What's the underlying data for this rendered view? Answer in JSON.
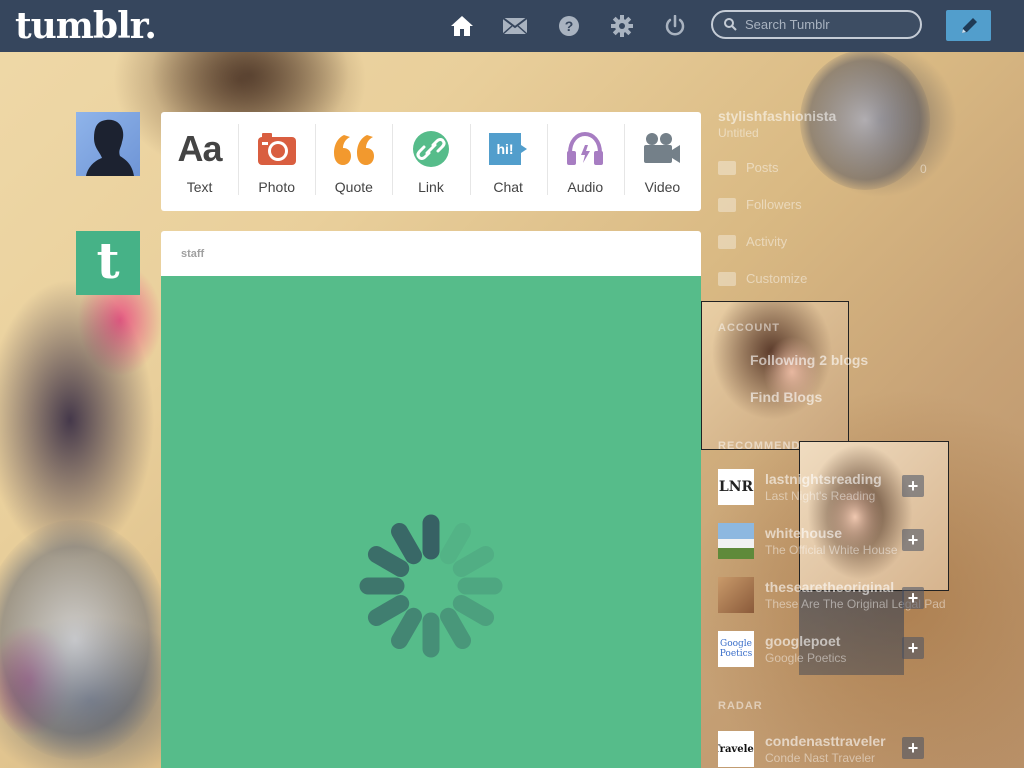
{
  "header": {
    "logo": "tumblr.",
    "search_placeholder": "Search Tumblr",
    "icons": [
      "home-icon",
      "mail-icon",
      "help-icon",
      "gear-icon",
      "power-icon"
    ]
  },
  "post_types": [
    {
      "label": "Text",
      "icon": "text-icon",
      "glyph": "Aa",
      "color": "#444444"
    },
    {
      "label": "Photo",
      "icon": "camera-icon",
      "color": "#d95e40"
    },
    {
      "label": "Quote",
      "icon": "quote-icon",
      "glyph": "“",
      "color": "#f2992e"
    },
    {
      "label": "Link",
      "icon": "link-icon",
      "color": "#56bc8a"
    },
    {
      "label": "Chat",
      "icon": "chat-icon",
      "glyph": "hi!",
      "color": "#529ecc"
    },
    {
      "label": "Audio",
      "icon": "headphones-icon",
      "color": "#a77dc2"
    },
    {
      "label": "Video",
      "icon": "video-camera-icon",
      "color": "#748089"
    }
  ],
  "post": {
    "author": "staff",
    "body_color": "#56bc8a",
    "state": "loading"
  },
  "sidebar": {
    "blog_name": "stylishfashionista",
    "blog_subtitle": "Untitled",
    "rows": [
      {
        "label": "Posts",
        "count": "0"
      },
      {
        "label": "Followers",
        "count": ""
      },
      {
        "label": "Activity",
        "count": ""
      },
      {
        "label": "Customize",
        "count": ""
      }
    ],
    "section_account": "ACCOUNT",
    "following": "Following 2 blogs",
    "find_blogs": "Find Blogs",
    "section_recommended": "RECOMMENDED BLOGS",
    "recommended": [
      {
        "name": "lastnightsreading",
        "sub": "Last Night's Reading",
        "thumb": "LNR"
      },
      {
        "name": "whitehouse",
        "sub": "The Official White House",
        "thumb": ""
      },
      {
        "name": "thesearetheoriginal",
        "sub": "These Are The Original Legal Pad",
        "thumb": ""
      },
      {
        "name": "googlepoet",
        "sub": "Google Poetics",
        "thumb": "Google Poetics"
      }
    ],
    "section_radar": "RADAR",
    "radar": {
      "name": "condenasttraveler",
      "sub": "Conde Nast Traveler",
      "thumb": "Traveler"
    }
  },
  "colors": {
    "header_bg": "#36465d",
    "compose": "#529ecc",
    "staff_avatar": "#46b287"
  }
}
